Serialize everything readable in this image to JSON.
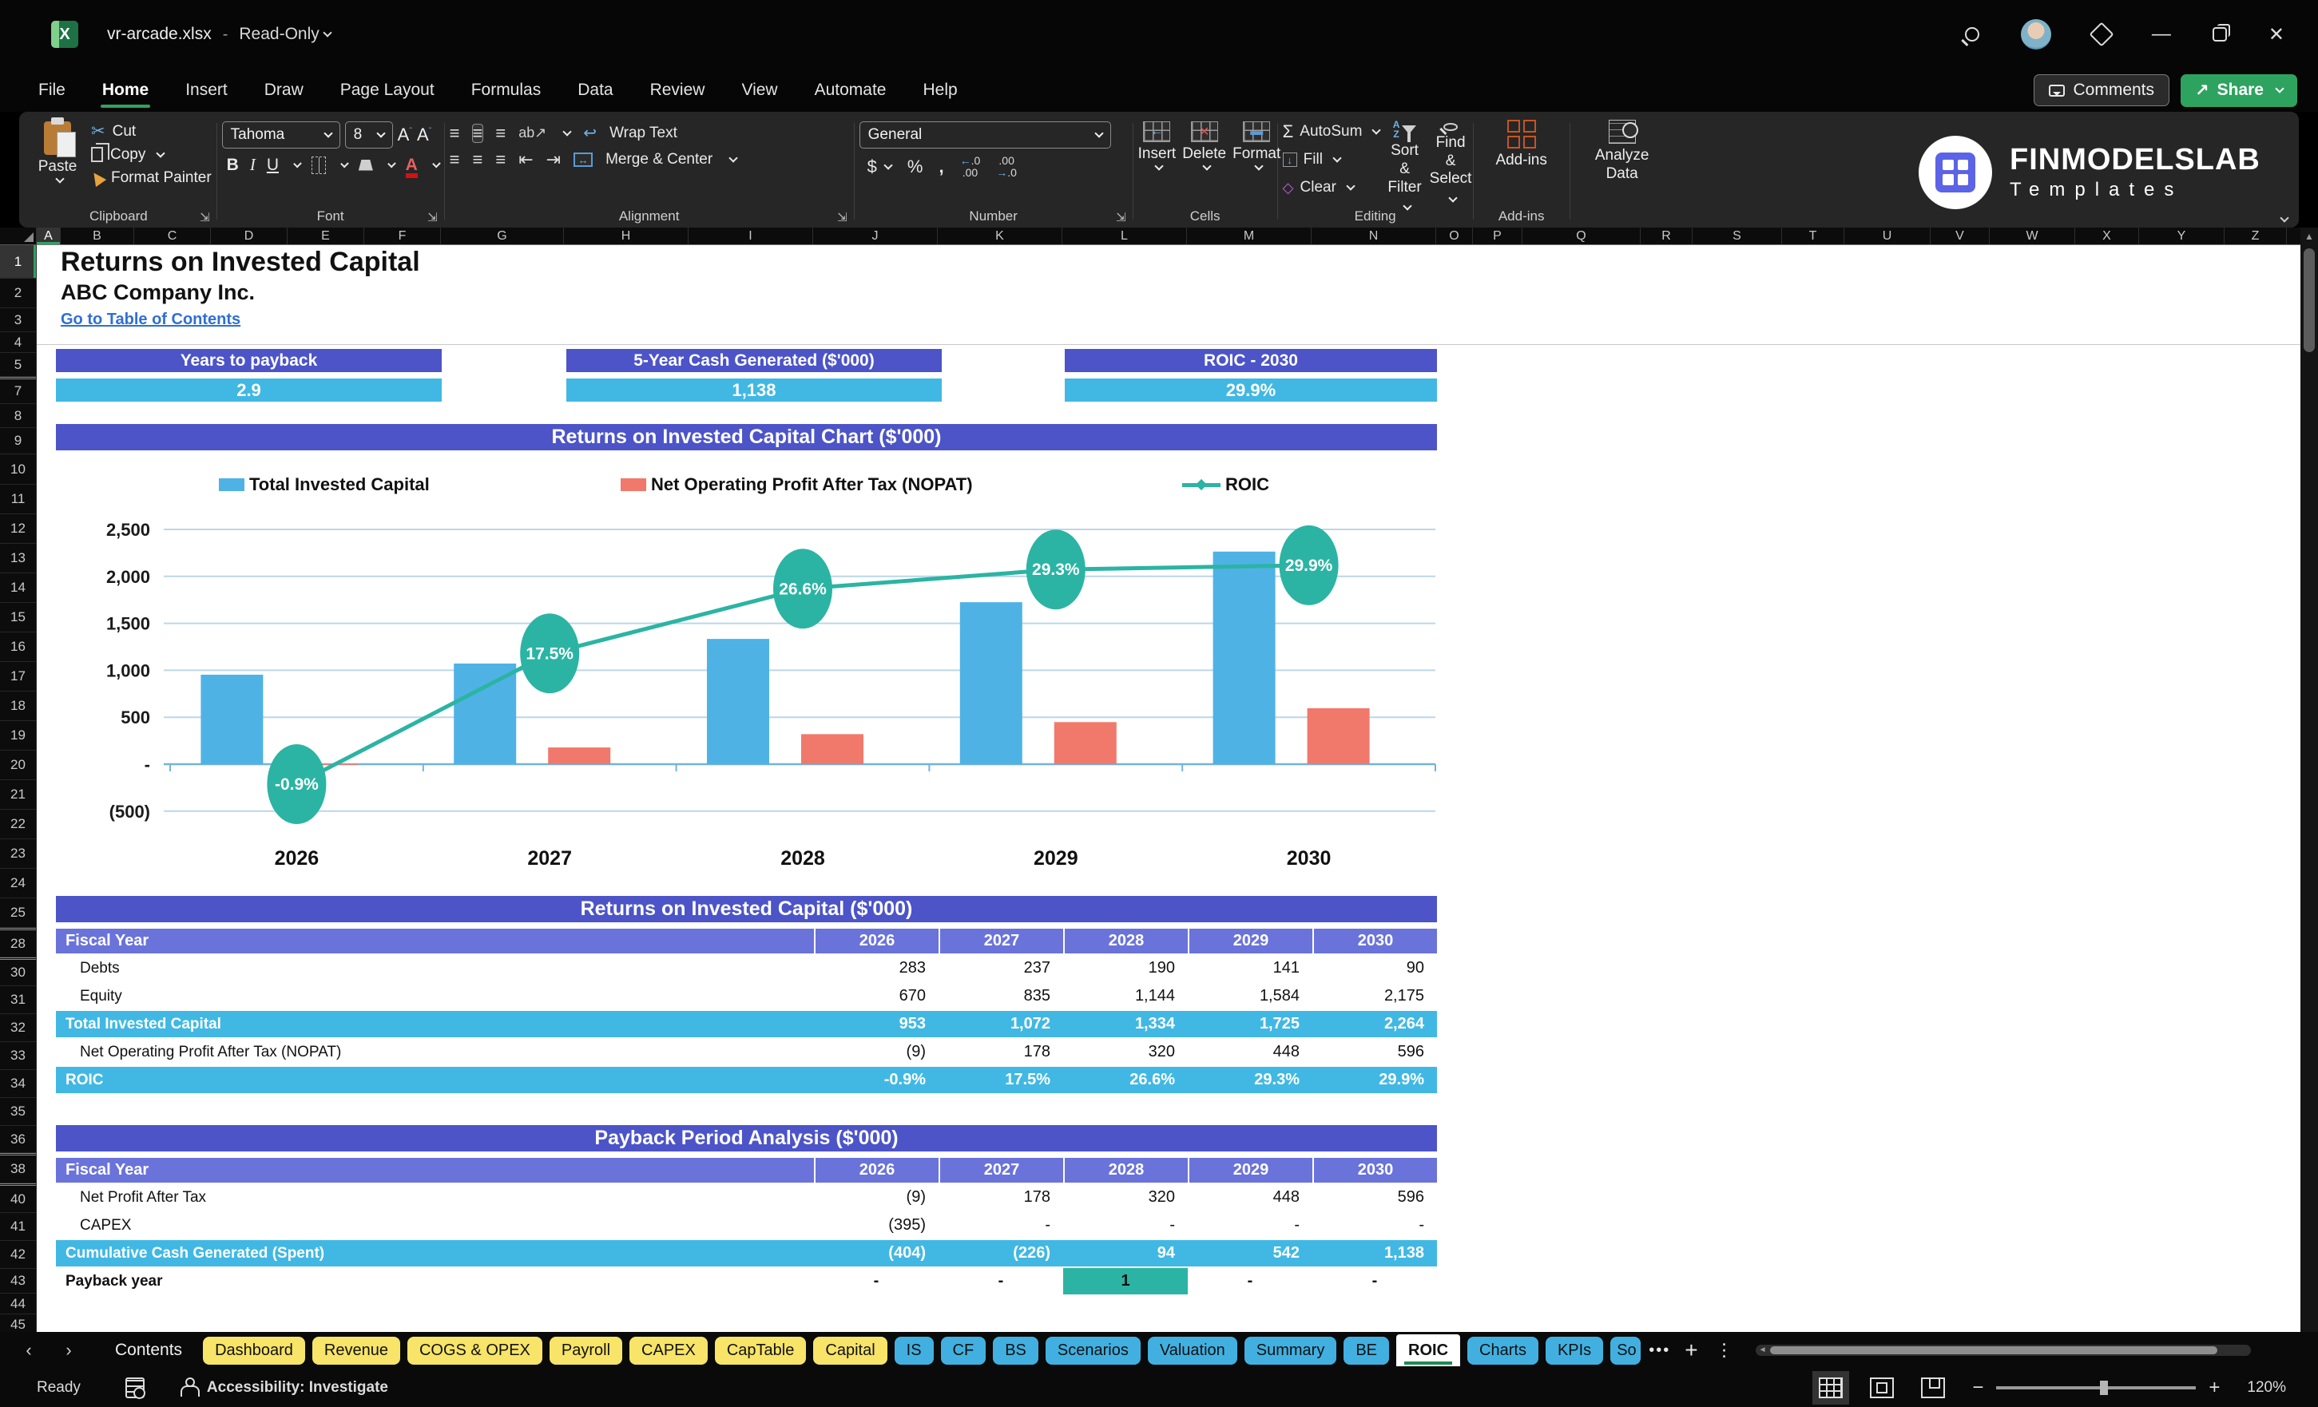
{
  "titlebar": {
    "filename": "vr-arcade.xlsx",
    "separator": "-",
    "mode": "Read-Only"
  },
  "ribbon": {
    "tabs": [
      "File",
      "Home",
      "Insert",
      "Draw",
      "Page Layout",
      "Formulas",
      "Data",
      "Review",
      "View",
      "Automate",
      "Help"
    ],
    "active_tab": "Home",
    "comments_label": "Comments",
    "share_label": "Share",
    "clipboard": {
      "paste": "Paste",
      "cut": "Cut",
      "copy": "Copy",
      "format_painter": "Format Painter",
      "group": "Clipboard"
    },
    "font": {
      "name": "Tahoma",
      "size": "8",
      "group": "Font"
    },
    "alignment": {
      "wrap": "Wrap Text",
      "merge": "Merge & Center",
      "group": "Alignment"
    },
    "number": {
      "format": "General",
      "group": "Number"
    },
    "cells": {
      "insert": "Insert",
      "delete": "Delete",
      "format": "Format",
      "group": "Cells"
    },
    "editing": {
      "autosum": "AutoSum",
      "fill": "Fill",
      "clear": "Clear",
      "sort1": "Sort &",
      "sort2": "Filter",
      "find1": "Find &",
      "find2": "Select",
      "group": "Editing"
    },
    "addins": {
      "label": "Add-ins",
      "group": "Add-ins"
    },
    "analyze": {
      "line1": "Analyze",
      "line2": "Data"
    },
    "brand": {
      "line1": "FINMODELSLAB",
      "line2": "Templates"
    }
  },
  "sheet": {
    "columns": [
      {
        "l": "A",
        "w": 30,
        "sel": true
      },
      {
        "l": "B",
        "w": 92
      },
      {
        "l": "C",
        "w": 96
      },
      {
        "l": "D",
        "w": 96
      },
      {
        "l": "E",
        "w": 96
      },
      {
        "l": "F",
        "w": 96
      },
      {
        "l": "G",
        "w": 154
      },
      {
        "l": "H",
        "w": 156
      },
      {
        "l": "I",
        "w": 156
      },
      {
        "l": "J",
        "w": 156
      },
      {
        "l": "K",
        "w": 156
      },
      {
        "l": "L",
        "w": 156
      },
      {
        "l": "M",
        "w": 156
      },
      {
        "l": "N",
        "w": 156
      },
      {
        "l": "O",
        "w": 46
      },
      {
        "l": "P",
        "w": 62
      },
      {
        "l": "Q",
        "w": 148
      },
      {
        "l": "R",
        "w": 65
      },
      {
        "l": "S",
        "w": 112
      },
      {
        "l": "T",
        "w": 78
      },
      {
        "l": "U",
        "w": 108
      },
      {
        "l": "V",
        "w": 74
      },
      {
        "l": "W",
        "w": 107
      },
      {
        "l": "X",
        "w": 80
      },
      {
        "l": "Y",
        "w": 107
      },
      {
        "l": "Z",
        "w": 78
      }
    ],
    "rows": [
      {
        "n": "1",
        "h": 42,
        "sel": true
      },
      {
        "n": "2",
        "h": 37
      },
      {
        "n": "3",
        "h": 30
      },
      {
        "n": "4",
        "h": 26
      },
      {
        "n": "5",
        "h": 30
      },
      {
        "n": "7",
        "h": 34,
        "cut": true
      },
      {
        "n": "8",
        "h": 30
      },
      {
        "n": "9",
        "h": 33
      },
      {
        "n": "10",
        "h": 38
      },
      {
        "n": "11",
        "h": 37
      },
      {
        "n": "12",
        "h": 37
      },
      {
        "n": "13",
        "h": 37
      },
      {
        "n": "14",
        "h": 37
      },
      {
        "n": "15",
        "h": 37
      },
      {
        "n": "16",
        "h": 37
      },
      {
        "n": "17",
        "h": 37
      },
      {
        "n": "18",
        "h": 37
      },
      {
        "n": "19",
        "h": 37
      },
      {
        "n": "20",
        "h": 37
      },
      {
        "n": "21",
        "h": 37
      },
      {
        "n": "22",
        "h": 37
      },
      {
        "n": "23",
        "h": 37
      },
      {
        "n": "24",
        "h": 37
      },
      {
        "n": "25",
        "h": 37
      },
      {
        "n": "28",
        "h": 37,
        "cut": true
      },
      {
        "n": "30",
        "h": 36,
        "cut": true
      },
      {
        "n": "31",
        "h": 35
      },
      {
        "n": "32",
        "h": 35
      },
      {
        "n": "33",
        "h": 35
      },
      {
        "n": "34",
        "h": 35
      },
      {
        "n": "35",
        "h": 35
      },
      {
        "n": "36",
        "h": 34
      },
      {
        "n": "38",
        "h": 38,
        "cut": true
      },
      {
        "n": "40",
        "h": 37,
        "cut": true
      },
      {
        "n": "41",
        "h": 35
      },
      {
        "n": "42",
        "h": 35
      },
      {
        "n": "43",
        "h": 31
      },
      {
        "n": "44",
        "h": 26
      },
      {
        "n": "45",
        "h": 26
      }
    ]
  },
  "page": {
    "title": "Returns on Invested Capital",
    "company": "ABC Company Inc.",
    "link": "Go to Table of Contents",
    "kpis": [
      {
        "label": "Years to payback",
        "value": "2.9"
      },
      {
        "label": "5-Year Cash Generated ($'000)",
        "value": "1,138"
      },
      {
        "label": "ROIC - 2030",
        "value": "29.9%"
      }
    ]
  },
  "chart_data": {
    "type": "combo",
    "title": "Returns on Invested Capital Chart ($'000)",
    "categories": [
      "2026",
      "2027",
      "2028",
      "2029",
      "2030"
    ],
    "series": [
      {
        "name": "Total Invested Capital",
        "type": "bar",
        "color": "#4FB2E5",
        "values": [
          953,
          1072,
          1334,
          1725,
          2264
        ]
      },
      {
        "name": "Net Operating Profit After Tax (NOPAT)",
        "type": "bar",
        "color": "#F0796C",
        "values": [
          -9,
          178,
          320,
          448,
          596
        ]
      },
      {
        "name": "ROIC",
        "type": "line",
        "color": "#2BB4A3",
        "values_pct": [
          -0.9,
          17.5,
          26.6,
          29.3,
          29.9
        ],
        "labels": [
          "-0.9%",
          "17.5%",
          "26.6%",
          "29.3%",
          "29.9%"
        ]
      }
    ],
    "y_axis": {
      "ticks": [
        "2,500",
        "2,000",
        "1,500",
        "1,000",
        "500",
        "-",
        "(500)"
      ],
      "tick_values": [
        2500,
        2000,
        1500,
        1000,
        500,
        0,
        -500
      ],
      "min": -500,
      "max": 2500
    },
    "legend_position": "top",
    "grid": true
  },
  "table1": {
    "banner": "Returns on Invested Capital ($'000)",
    "header": {
      "label": "Fiscal Year",
      "years": [
        "2026",
        "2027",
        "2028",
        "2029",
        "2030"
      ]
    },
    "rows": [
      {
        "label": "Debts",
        "values": [
          "283",
          "237",
          "190",
          "141",
          "90"
        ],
        "style": "plain"
      },
      {
        "label": "Equity",
        "values": [
          "670",
          "835",
          "1,144",
          "1,584",
          "2,175"
        ],
        "style": "plain"
      },
      {
        "label": "Total Invested Capital",
        "values": [
          "953",
          "1,072",
          "1,334",
          "1,725",
          "2,264"
        ],
        "style": "highlight"
      },
      {
        "label": "Net Operating Profit After Tax (NOPAT)",
        "values": [
          "(9)",
          "178",
          "320",
          "448",
          "596"
        ],
        "style": "plain"
      },
      {
        "label": "ROIC",
        "values": [
          "-0.9%",
          "17.5%",
          "26.6%",
          "29.3%",
          "29.9%"
        ],
        "style": "highlight"
      }
    ]
  },
  "table2": {
    "banner": "Payback Period Analysis ($'000)",
    "header": {
      "label": "Fiscal Year",
      "years": [
        "2026",
        "2027",
        "2028",
        "2029",
        "2030"
      ]
    },
    "rows": [
      {
        "label": "Net Profit After Tax",
        "values": [
          "(9)",
          "178",
          "320",
          "448",
          "596"
        ],
        "style": "plain"
      },
      {
        "label": "CAPEX",
        "values": [
          "(395)",
          "-",
          "-",
          "-",
          "-"
        ],
        "style": "plain"
      },
      {
        "label": "Cumulative Cash Generated (Spent)",
        "values": [
          "(404)",
          "(226)",
          "94",
          "542",
          "1,138"
        ],
        "style": "highlight"
      },
      {
        "label": "Payback year",
        "values": [
          "-",
          "-",
          "1",
          "-",
          "-"
        ],
        "style": "payback",
        "highlight_col": 2
      }
    ]
  },
  "tabstrip": {
    "home_tab": "Contents",
    "tabs": [
      {
        "label": "Dashboard",
        "c": "yellow"
      },
      {
        "label": "Revenue",
        "c": "yellow"
      },
      {
        "label": "COGS & OPEX",
        "c": "yellow"
      },
      {
        "label": "Payroll",
        "c": "yellow"
      },
      {
        "label": "CAPEX",
        "c": "yellow"
      },
      {
        "label": "CapTable",
        "c": "yellow"
      },
      {
        "label": "Capital",
        "c": "yellow"
      },
      {
        "label": "IS",
        "c": "blue"
      },
      {
        "label": "CF",
        "c": "blue"
      },
      {
        "label": "BS",
        "c": "blue"
      },
      {
        "label": "Scenarios",
        "c": "blue"
      },
      {
        "label": "Valuation",
        "c": "blue"
      },
      {
        "label": "Summary",
        "c": "blue"
      },
      {
        "label": "BE",
        "c": "blue"
      },
      {
        "label": "ROIC",
        "c": "active"
      },
      {
        "label": "Charts",
        "c": "blue"
      },
      {
        "label": "KPIs",
        "c": "blue"
      },
      {
        "label": "So",
        "c": "bluecut"
      }
    ],
    "more": "•••"
  },
  "statusbar": {
    "ready": "Ready",
    "accessibility": "Accessibility: Investigate",
    "zoom": "120%"
  },
  "colors": {
    "banner_purple": "#4C54C8",
    "header_purple": "#6A73DA",
    "highlight_cyan": "#41B8E3",
    "payback_teal": "#2BB4A3",
    "bar_blue": "#4FB2E5",
    "bar_red": "#F0796C",
    "line_teal": "#2BB4A3",
    "tab_yellow": "#F7E468",
    "tab_blue": "#41B0E0",
    "excel_green": "#2EA35F",
    "link_blue": "#2E6FD6"
  }
}
